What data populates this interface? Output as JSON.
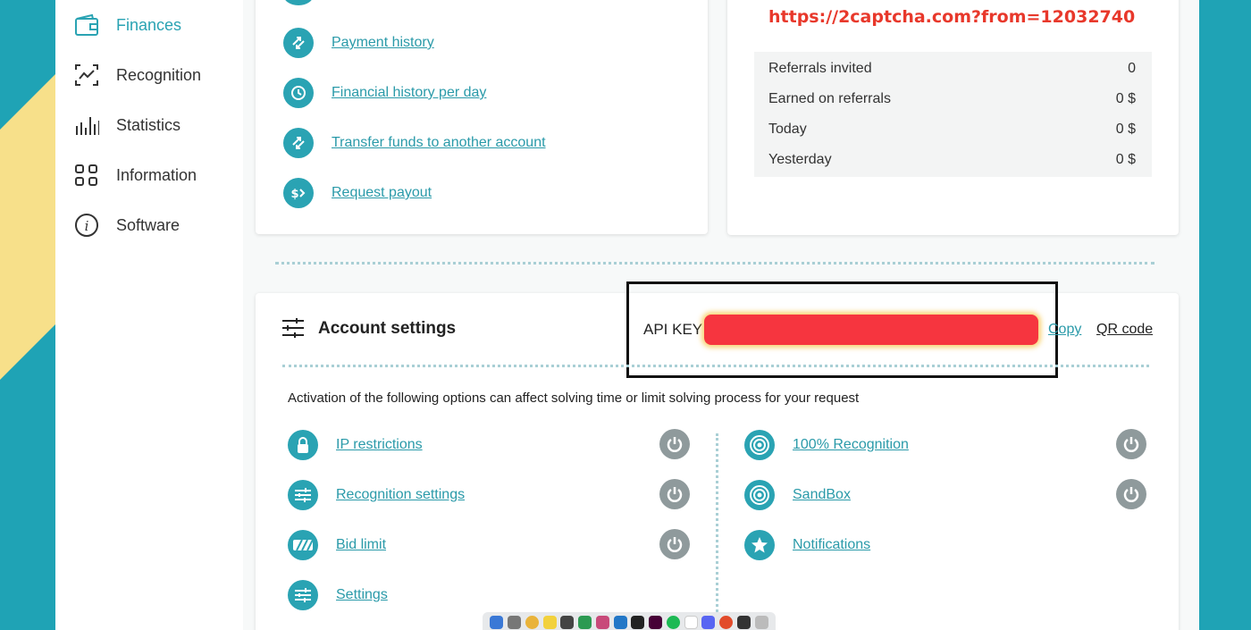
{
  "sidebar": {
    "items": [
      {
        "label": "Finances",
        "icon": "wallet-icon",
        "active": true
      },
      {
        "label": "Recognition",
        "icon": "recognition-icon"
      },
      {
        "label": "Statistics",
        "icon": "bar-chart-icon"
      },
      {
        "label": "Information",
        "icon": "grid-icon"
      },
      {
        "label": "Software",
        "icon": "info-icon"
      }
    ]
  },
  "finances_links": [
    {
      "label": "Payment history",
      "icon": "transfer-arrows-icon"
    },
    {
      "label": "Financial history per day",
      "icon": "clock-history-icon"
    },
    {
      "label": "Transfer funds to another account",
      "icon": "transfer-arrows-icon"
    },
    {
      "label": "Request payout",
      "icon": "dollar-arrow-icon"
    }
  ],
  "referral": {
    "url": "https://2captcha.com?from=12032740",
    "rows": [
      {
        "label": "Referrals invited",
        "value": "0"
      },
      {
        "label": "Earned on referrals",
        "value": "0 $"
      },
      {
        "label": "Today",
        "value": "0 $"
      },
      {
        "label": "Yesterday",
        "value": "0 $"
      }
    ]
  },
  "account_settings": {
    "title": "Account settings",
    "api_key_label": "API KEY",
    "copy_label": "Copy",
    "qr_label": "QR code",
    "notice": "Activation of the following options can affect solving time or limit solving process for your request",
    "left_options": [
      {
        "label": "IP restrictions",
        "icon": "lock-icon",
        "toggle": true
      },
      {
        "label": "Recognition settings",
        "icon": "sliders-icon",
        "toggle": true
      },
      {
        "label": "Bid limit",
        "icon": "stripes-icon",
        "toggle": true
      },
      {
        "label": "Settings",
        "icon": "sliders-icon",
        "toggle": false
      }
    ],
    "right_options": [
      {
        "label": "100% Recognition",
        "icon": "target-icon",
        "toggle": true
      },
      {
        "label": "SandBox",
        "icon": "target-icon",
        "toggle": true
      },
      {
        "label": "Notifications",
        "icon": "star-icon",
        "toggle": false
      }
    ]
  },
  "colors": {
    "accent": "#2aa3b3",
    "background": "#1fa3b5",
    "highlight_red": "#e8382b",
    "toggle_gray": "#8f9a9c"
  }
}
